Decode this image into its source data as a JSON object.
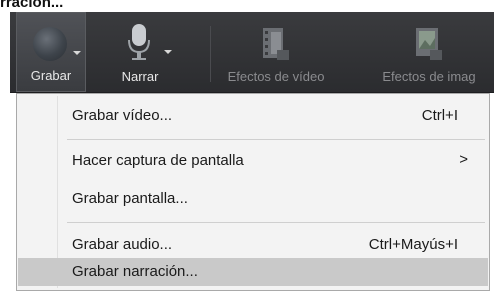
{
  "caption": "rración...",
  "toolbar": {
    "buttons": [
      {
        "label": "Grabar"
      },
      {
        "label": "Narrar"
      },
      {
        "label": "Efectos de vídeo"
      },
      {
        "label": "Efectos de imag"
      }
    ]
  },
  "menu": {
    "items": [
      {
        "label": "Grabar vídeo...",
        "shortcut": "Ctrl+I"
      },
      {
        "label": "Hacer captura de pantalla",
        "submenu": ">"
      },
      {
        "label": "Grabar pantalla..."
      },
      {
        "label": "Grabar audio...",
        "shortcut": "Ctrl+Mayús+I"
      },
      {
        "label": "Grabar narración..."
      }
    ]
  },
  "colors": {
    "toolbar_bg": "#2b2c2f",
    "menu_bg": "#f3f3f3",
    "highlight": "#c9c9c9"
  },
  "icons": [
    "record-icon",
    "microphone-icon",
    "video-effects-icon",
    "image-effects-icon",
    "chevron-down-icon",
    "submenu-arrow-icon"
  ]
}
